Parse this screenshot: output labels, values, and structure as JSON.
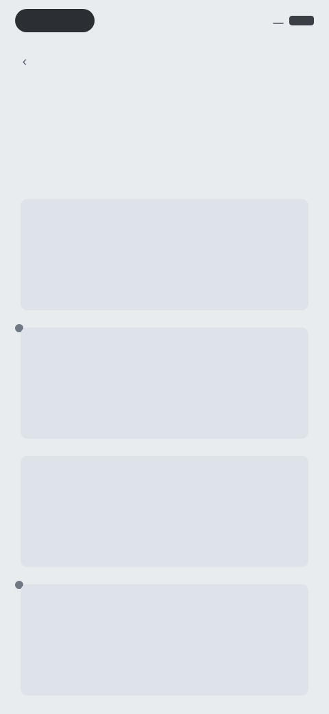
{
  "status_bar": {
    "pill_label": "",
    "time": ""
  },
  "header": {
    "back_icon": "chevron-left-icon",
    "title": "",
    "subtitle": ""
  },
  "cards": [
    {
      "title": "",
      "description": "",
      "meta": "",
      "action": ""
    },
    {
      "title": "",
      "description": "",
      "meta": "",
      "action": ""
    },
    {
      "title": "",
      "description": "",
      "meta": "",
      "action": ""
    },
    {
      "title": "",
      "description": "",
      "meta": "",
      "action": ""
    }
  ],
  "colors": {
    "background": "#e9ecef",
    "card": "#dde3e8",
    "pill": "#2b2f33",
    "text": "#2f3b47"
  }
}
